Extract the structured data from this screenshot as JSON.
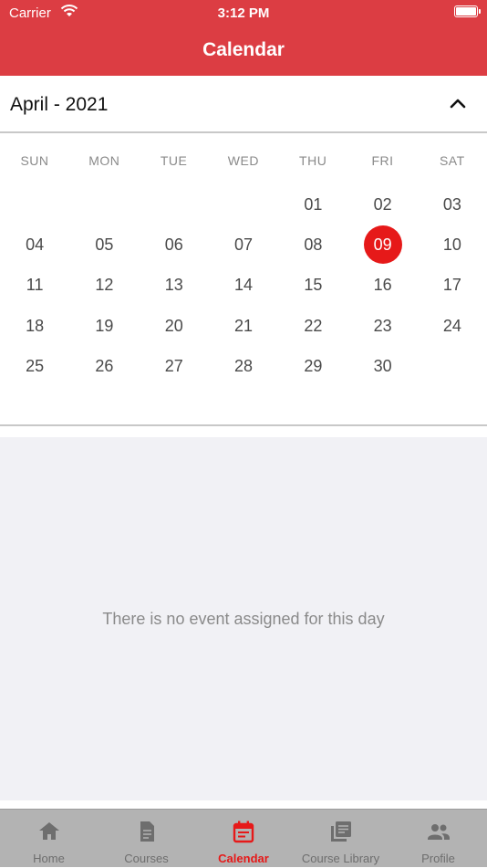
{
  "status_bar": {
    "carrier": "Carrier",
    "time": "3:12 PM"
  },
  "nav": {
    "title": "Calendar"
  },
  "calendar": {
    "month_label": "April - 2021",
    "weekdays": [
      "SUN",
      "MON",
      "TUE",
      "WED",
      "THU",
      "FRI",
      "SAT"
    ],
    "first_weekday_index": 4,
    "days": [
      "01",
      "02",
      "03",
      "04",
      "05",
      "06",
      "07",
      "08",
      "09",
      "10",
      "11",
      "12",
      "13",
      "14",
      "15",
      "16",
      "17",
      "18",
      "19",
      "20",
      "21",
      "22",
      "23",
      "24",
      "25",
      "26",
      "27",
      "28",
      "29",
      "30"
    ],
    "selected_day": "09"
  },
  "events": {
    "empty_message": "There is no event assigned for this day"
  },
  "tabs": [
    {
      "label": "Home",
      "icon": "home-icon",
      "active": false
    },
    {
      "label": "Courses",
      "icon": "document-icon",
      "active": false
    },
    {
      "label": "Calendar",
      "icon": "calendar-icon",
      "active": true
    },
    {
      "label": "Course Library",
      "icon": "library-icon",
      "active": false
    },
    {
      "label": "Profile",
      "icon": "people-icon",
      "active": false
    }
  ],
  "colors": {
    "brand_red": "#dc3d43",
    "selected_red": "#e61919",
    "tab_bar": "#b3b3b3",
    "panel_bg": "#f1f1f5"
  }
}
